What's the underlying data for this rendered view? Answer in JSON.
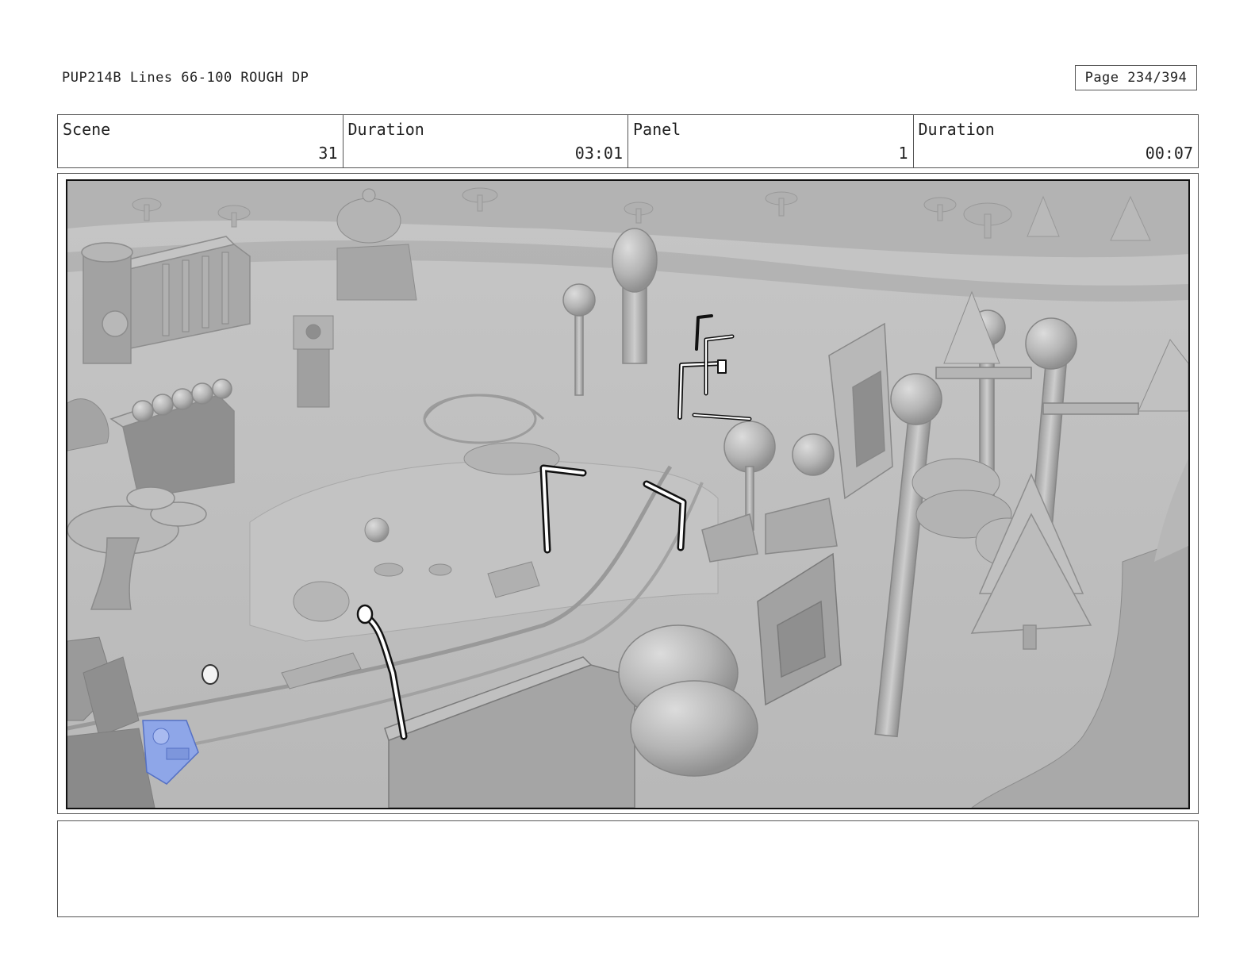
{
  "header": {
    "title": "PUP214B Lines 66-100 ROUGH DP",
    "page": "Page 234/394"
  },
  "info": {
    "scene_label": "Scene",
    "scene_value": "31",
    "scene_duration_label": "Duration",
    "scene_duration_value": "03:01",
    "panel_label": "Panel",
    "panel_value": "1",
    "panel_duration_label": "Duration",
    "panel_duration_value": "00:07"
  },
  "notes": {
    "text": ""
  }
}
